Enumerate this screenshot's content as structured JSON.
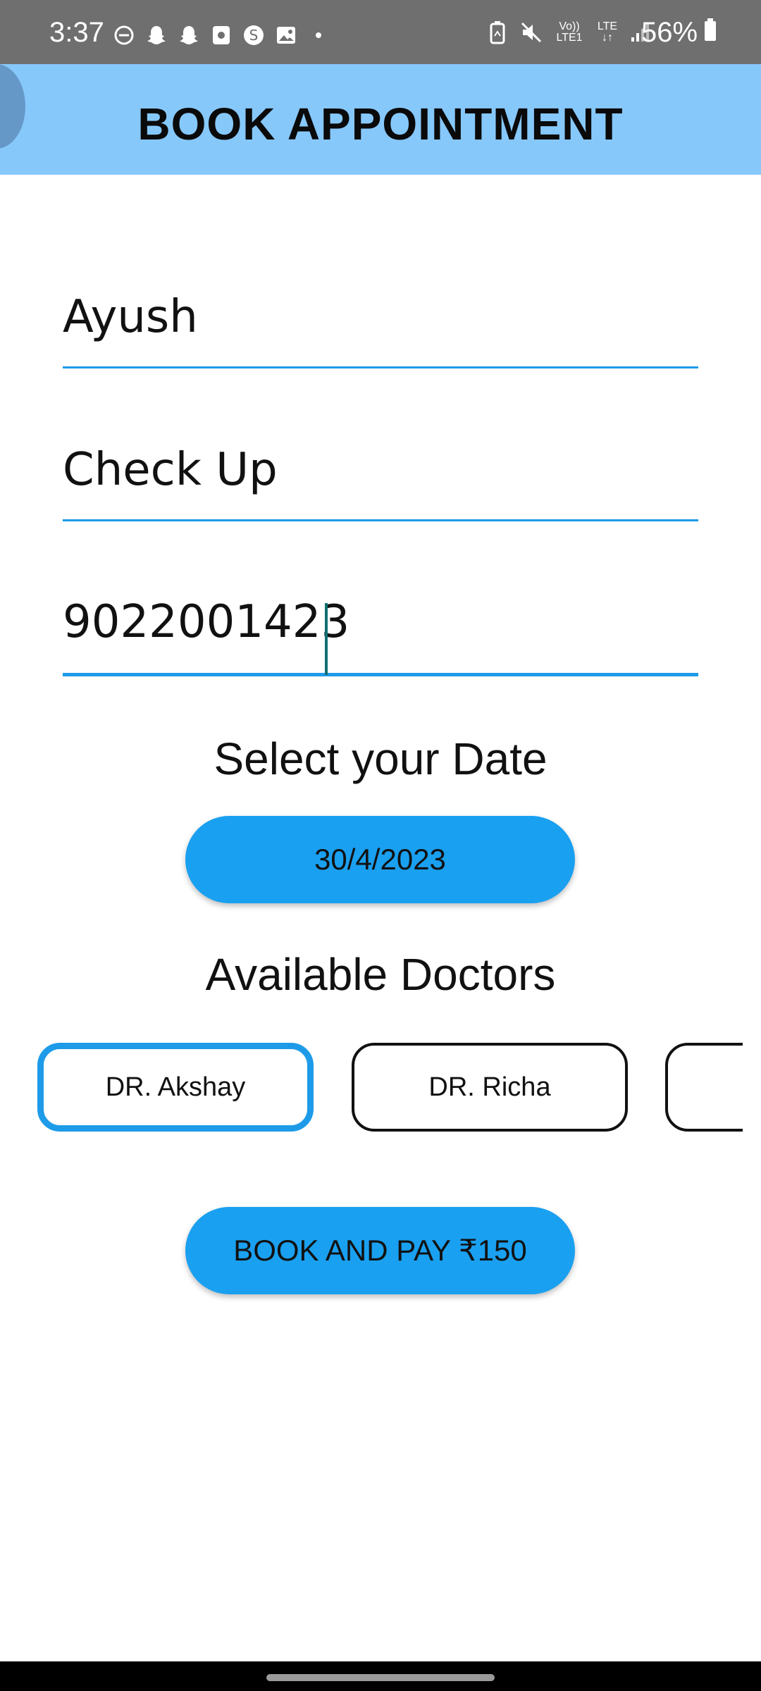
{
  "status_bar": {
    "time": "3:37",
    "battery": "56%",
    "network_top": "Vo))",
    "network_bottom": "LTE1",
    "lte_label": "LTE",
    "icons_left": [
      "do-not-disturb-icon",
      "snapchat-icon",
      "snapchat-icon",
      "app-icon",
      "threads-icon",
      "gallery-icon",
      "dot-icon"
    ],
    "icons_right": [
      "battery-saver-icon",
      "mute-icon",
      "volte-icon",
      "lte-icon",
      "signal-icon",
      "battery-icon"
    ]
  },
  "app_bar": {
    "title": "BOOK APPOINTMENT",
    "color": "#87c8fb"
  },
  "form": {
    "name_value": "Ayush",
    "reason_value": "Check Up",
    "phone_value": "9022001423"
  },
  "date_section": {
    "label": "Select your Date",
    "date_value": "30/4/2023"
  },
  "doctors_section": {
    "label": "Available Doctors",
    "doctors": [
      "DR. Akshay",
      "DR. Richa",
      ""
    ],
    "selected_index": 0
  },
  "book_button": {
    "label": "BOOK AND PAY ₹150"
  },
  "colors": {
    "accent": "#1aa0f0",
    "underline": "#1e9be8"
  }
}
